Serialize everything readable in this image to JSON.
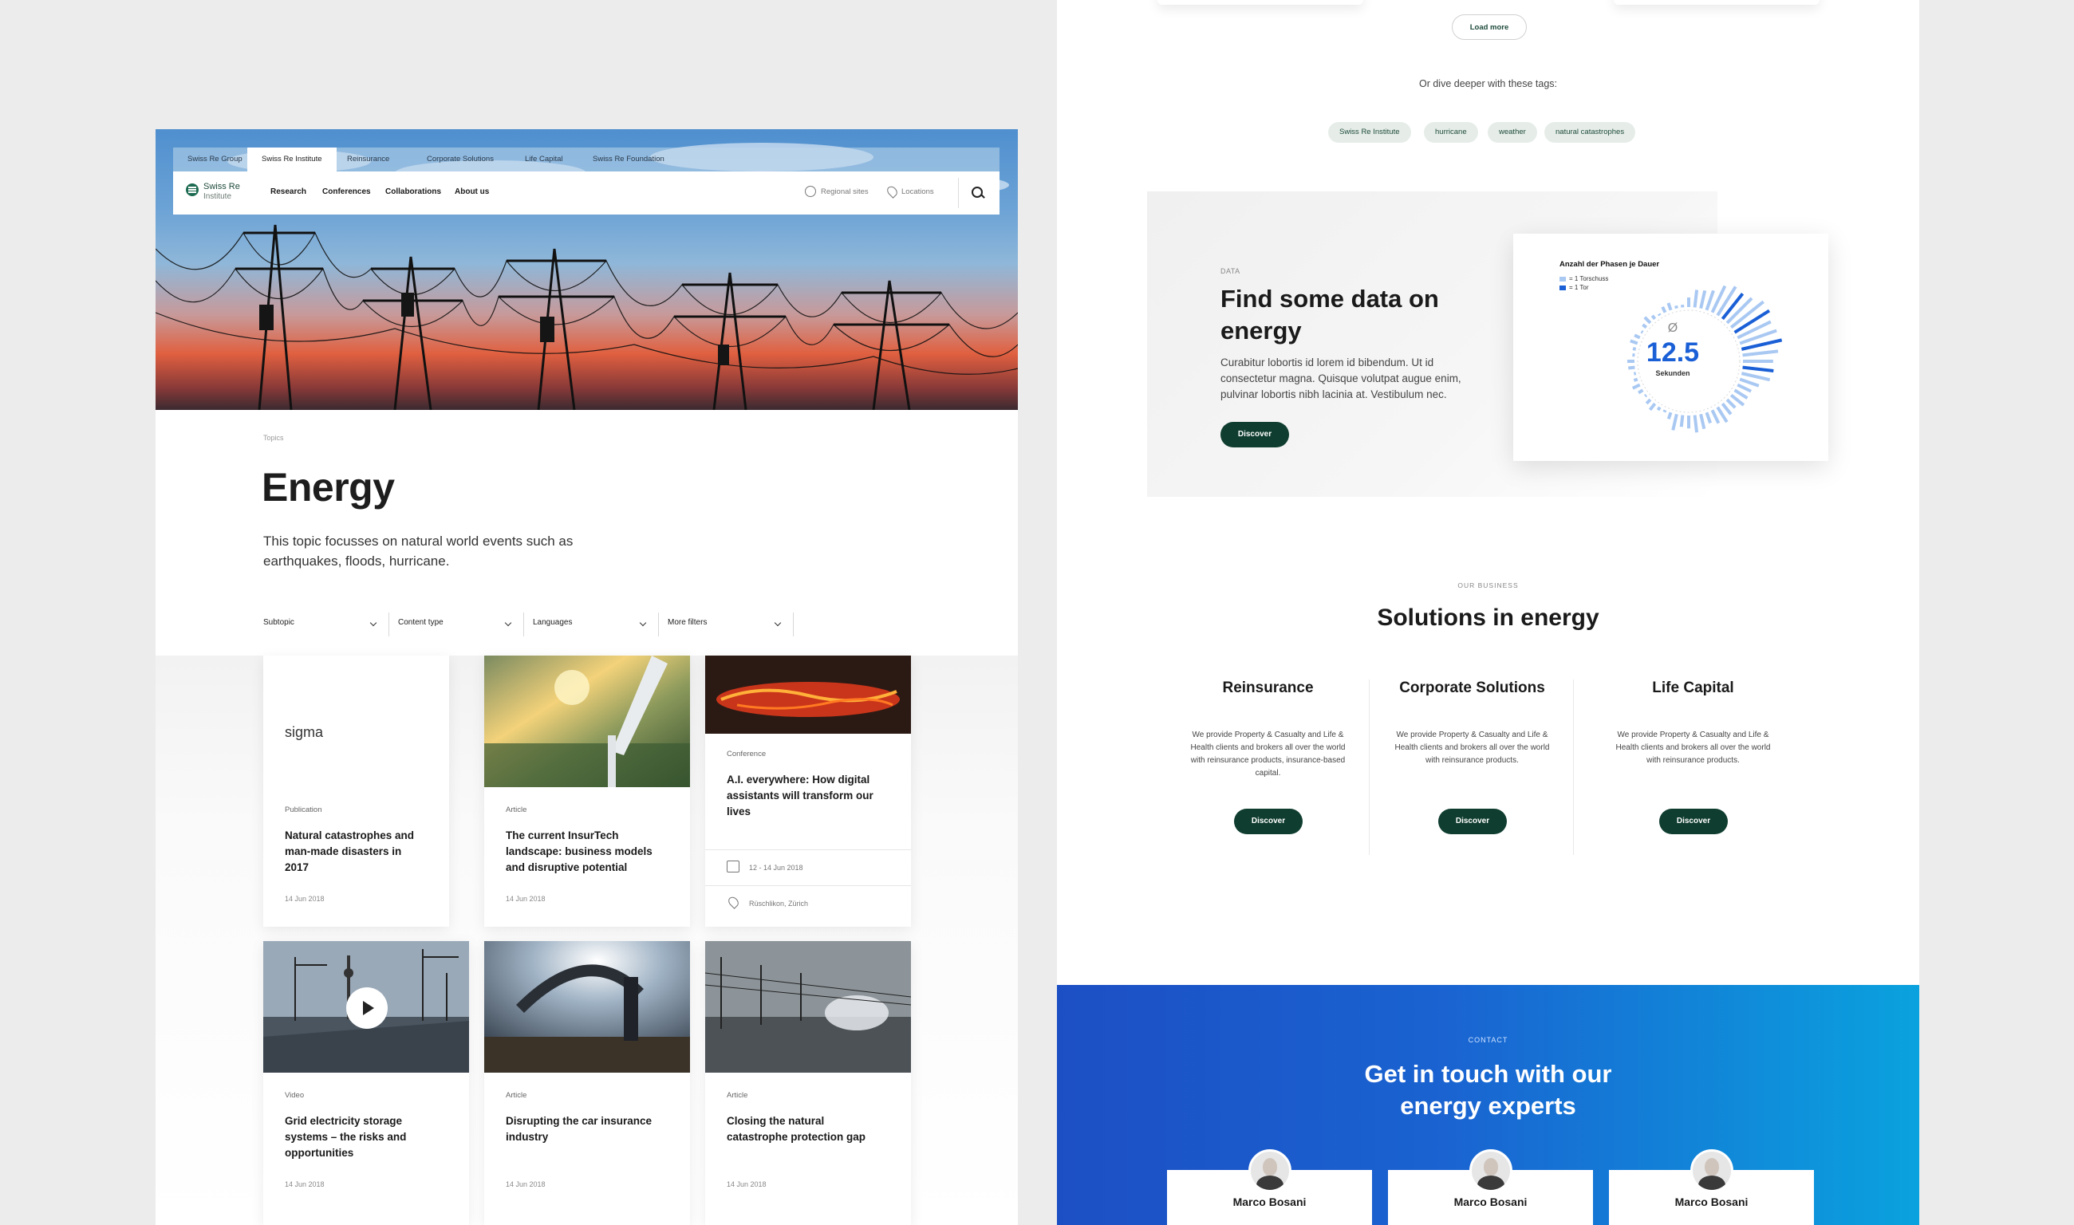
{
  "left": {
    "hero": {
      "meta_nav": [
        "Swiss Re Group",
        "Swiss Re Institute",
        "Reinsurance",
        "Corporate Solutions",
        "Life Capital",
        "Swiss Re Foundation"
      ],
      "meta_active": "Swiss Re Institute",
      "logo_name": "Swiss Re",
      "logo_sub": "Institute",
      "main_nav": [
        "Research",
        "Conferences",
        "Collaborations",
        "About us"
      ],
      "regional_sites": "Regional sites",
      "locations": "Locations"
    },
    "breadcrumb": "Topics",
    "title": "Energy",
    "description": "This topic focusses on natural world events such as earthquakes, floods, hurricane.",
    "filters": [
      "Subtopic",
      "Content type",
      "Languages",
      "More filters"
    ],
    "cards": [
      {
        "brand": "sigma",
        "type": "Publication",
        "title": "Natural catastrophes and man-made disasters in 2017",
        "date": "14 Jun 2018"
      },
      {
        "type": "Article",
        "title": "The current InsurTech landscape: business models and disruptive potential",
        "date": "14 Jun 2018"
      },
      {
        "type": "Conference",
        "title": "A.I. everywhere: How digital assistants will transform our lives",
        "date_range": "12 - 14 Jun 2018",
        "location": "Rüschlikon, Zürich"
      },
      {
        "type": "Video",
        "title": "Grid electricity storage systems – the risks and opportunities",
        "date": "14 Jun 2018"
      },
      {
        "type": "Article",
        "title": "Disrupting the car insurance industry",
        "date": "14 Jun 2018"
      },
      {
        "type": "Article",
        "title": "Closing the natural catastrophe protection gap",
        "date": "14 Jun 2018"
      }
    ]
  },
  "right": {
    "load_more": "Load more",
    "tags_heading": "Or dive deeper with these tags:",
    "tags": [
      "Swiss Re Institute",
      "hurricane",
      "weather",
      "natural catastrophes"
    ],
    "data": {
      "eyebrow": "DATA",
      "title": "Find some data on energy",
      "description": "Curabitur lobortis id lorem id bibendum. Ut id consectetur magna. Quisque volutpat augue enim, pulvinar lobortis nibh lacinia at. Vestibulum nec.",
      "button": "Discover",
      "chart": {
        "title": "Anzahl der Phasen je Dauer",
        "legend": [
          {
            "label": "= 1 Torschuss",
            "color": "#a9c8f2"
          },
          {
            "label": "= 1 Tor",
            "color": "#1a5fd6"
          }
        ],
        "mean_symbol": "Ø",
        "value": "12.5",
        "unit": "Sekunden"
      }
    },
    "business": {
      "eyebrow": "OUR BUSINESS",
      "title": "Solutions in energy",
      "columns": [
        {
          "title": "Reinsurance",
          "description": "We provide Property & Casualty and Life & Health clients and brokers all over the world with reinsurance products, insurance-based capital.",
          "button": "Discover"
        },
        {
          "title": "Corporate Solutions",
          "description": "We provide Property & Casualty and Life & Health clients and brokers all over the world with reinsurance products.",
          "button": "Discover"
        },
        {
          "title": "Life Capital",
          "description": "We provide Property & Casualty and Life & Health clients and brokers all over the world with reinsurance products.",
          "button": "Discover"
        }
      ]
    },
    "contact": {
      "eyebrow": "CONTACT",
      "title": "Get in touch with our energy experts",
      "people": [
        "Marco Bosani",
        "Marco Bosani",
        "Marco Bosani"
      ]
    }
  }
}
